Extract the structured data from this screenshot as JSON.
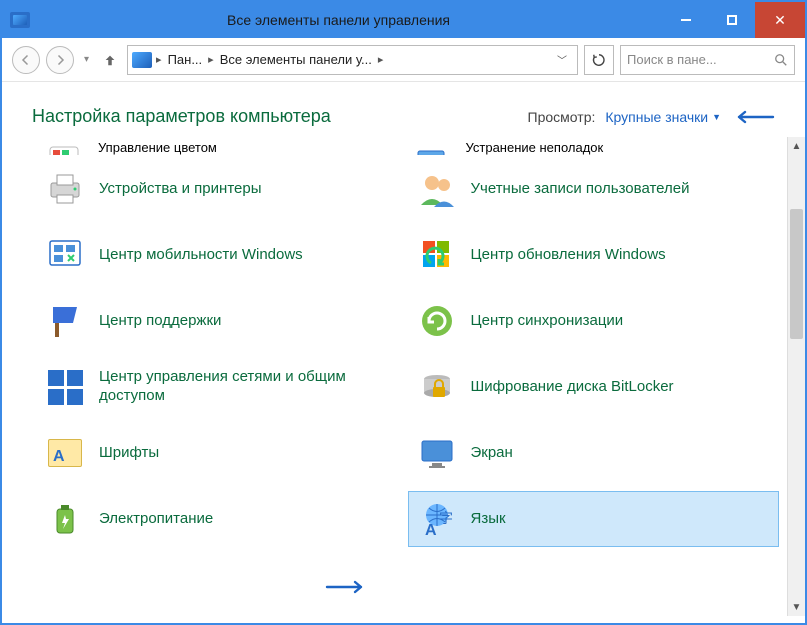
{
  "window": {
    "title": "Все элементы панели управления"
  },
  "addressbar": {
    "segments": [
      "Пан...",
      "Все элементы панели у..."
    ],
    "search_placeholder": "Поиск в пане..."
  },
  "header": {
    "title": "Настройка параметров компьютера",
    "view_label": "Просмотр:",
    "view_mode": "Крупные значки"
  },
  "items_cut": [
    {
      "label": "Управление цветом",
      "icon": "color-management-icon"
    },
    {
      "label": "Устранение неполадок",
      "icon": "troubleshoot-icon"
    }
  ],
  "items": [
    {
      "label": "Устройства и принтеры",
      "icon": "devices-printers-icon"
    },
    {
      "label": "Учетные записи пользователей",
      "icon": "user-accounts-icon"
    },
    {
      "label": "Центр мобильности Windows",
      "icon": "mobility-center-icon"
    },
    {
      "label": "Центр обновления Windows",
      "icon": "windows-update-icon"
    },
    {
      "label": "Центр поддержки",
      "icon": "action-center-icon"
    },
    {
      "label": "Центр синхронизации",
      "icon": "sync-center-icon"
    },
    {
      "label": "Центр управления сетями и общим доступом",
      "icon": "network-sharing-icon"
    },
    {
      "label": "Шифрование диска BitLocker",
      "icon": "bitlocker-icon"
    },
    {
      "label": "Шрифты",
      "icon": "fonts-icon"
    },
    {
      "label": "Экран",
      "icon": "display-icon"
    },
    {
      "label": "Электропитание",
      "icon": "power-options-icon"
    },
    {
      "label": "Язык",
      "icon": "language-icon",
      "selected": true
    }
  ]
}
